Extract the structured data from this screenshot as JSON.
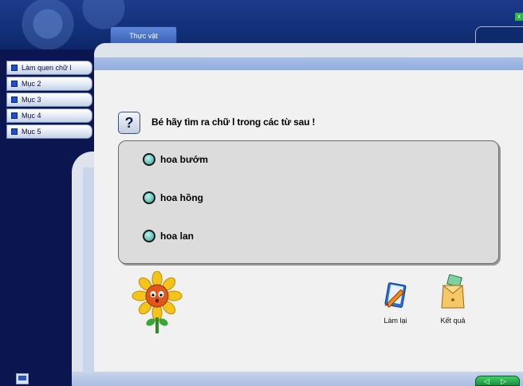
{
  "window": {
    "close_label": "x"
  },
  "tabs": [
    {
      "label": "Thực vật"
    }
  ],
  "sidebar": {
    "items": [
      {
        "label": "Làm quen chữ l"
      },
      {
        "label": "Mục 2"
      },
      {
        "label": "Mục 3"
      },
      {
        "label": "Mục 4"
      },
      {
        "label": "Mục 5"
      }
    ]
  },
  "question": {
    "icon_label": "?",
    "text": "Bé hãy tìm ra chữ l trong các từ sau !"
  },
  "options": [
    {
      "label": "hoa bướm"
    },
    {
      "label": "hoa hồng"
    },
    {
      "label": "hoa lan"
    }
  ],
  "actions": {
    "retry_label": "Làm lại",
    "result_label": "Kết quả"
  },
  "nav": {
    "label": "◁ ▷"
  },
  "colors": {
    "background": "#0b1650",
    "header": "#123078",
    "accent_bar": "#93aedd",
    "content": "#f1f1f1",
    "radio": "#6fc9c2"
  },
  "icons": [
    "question-icon",
    "sunflower-icon",
    "notebook-pencil-icon",
    "envelope-card-icon",
    "monitor-icon",
    "close-icon"
  ]
}
